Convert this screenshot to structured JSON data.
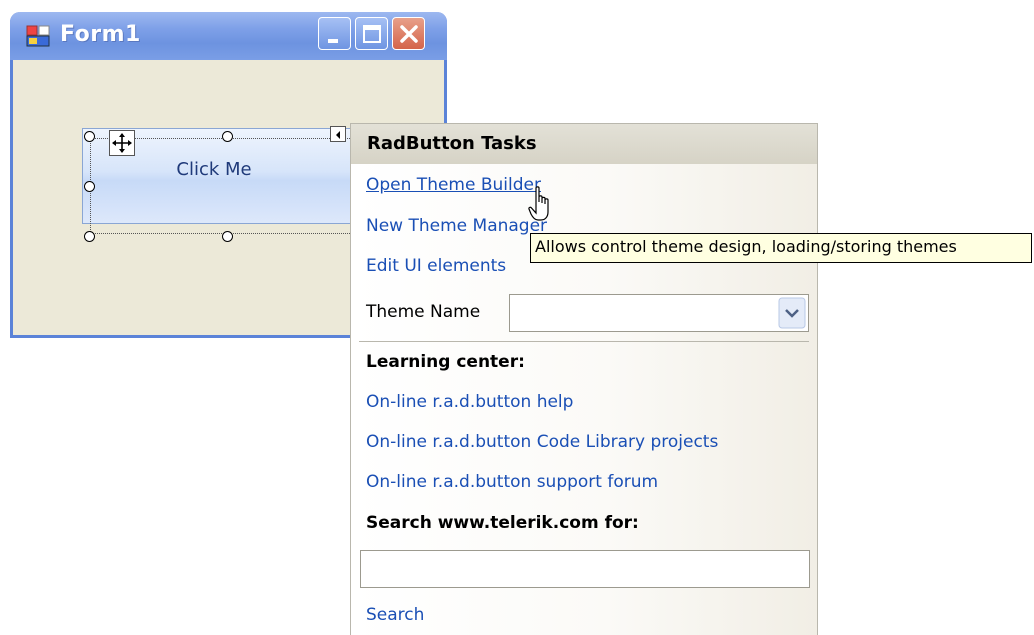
{
  "window": {
    "title": "Form1",
    "button_label": "Click Me"
  },
  "tasks_panel": {
    "title": "RadButton Tasks",
    "links": {
      "open_theme_builder": "Open Theme Builder",
      "new_theme_manager": "New Theme Manager",
      "edit_ui_elements": "Edit UI elements"
    },
    "theme_name_label": "Theme Name",
    "theme_name_value": "",
    "learning_center_label": "Learning center:",
    "learning_links": {
      "help": "On-line r.a.d.button help",
      "code_library": "On-line r.a.d.button Code Library projects",
      "support_forum": "On-line r.a.d.button support forum"
    },
    "search_label": "Search www.telerik.com for:",
    "search_value": "",
    "search_link": "Search"
  },
  "tooltip": {
    "text": "Allows control theme design, loading/storing themes"
  },
  "icons": {
    "app": "form-app-icon",
    "minimize": "minimize-icon",
    "maximize": "maximize-icon",
    "close": "close-icon",
    "move": "move-icon",
    "smart_tag": "smart-tag-arrow-icon",
    "dropdown": "chevron-down-icon",
    "cursor": "hand-pointer-icon"
  },
  "colors": {
    "titlebar": "#7ea0e8",
    "link": "#1a4fb5",
    "tooltip_bg": "#ffffe1",
    "form_bg": "#ece9d8"
  }
}
